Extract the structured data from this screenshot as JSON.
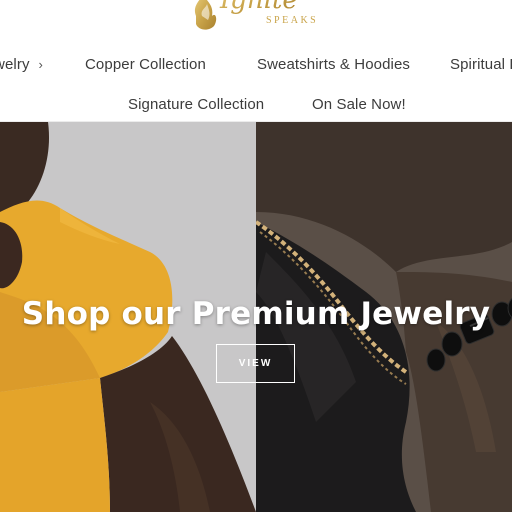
{
  "brand": {
    "logo_script": "Ignite",
    "logo_sub": "SPEAKS",
    "logo_color": "#c9a44a"
  },
  "nav": {
    "row1": [
      {
        "label": "Jewelry",
        "has_chevron": true,
        "chevron": "›"
      },
      {
        "label": "Copper Collection"
      },
      {
        "label": "Sweatshirts & Hoodies"
      },
      {
        "label": "Spiritual B"
      }
    ],
    "row2": [
      {
        "label": "Signature Collection"
      },
      {
        "label": "On Sale Now!"
      }
    ]
  },
  "hero": {
    "heading": "Shop our Premium Jewelry",
    "button_label": "VIEW",
    "left_bg": "#c8c7c8",
    "shirt_color": "#e7a92d",
    "right_bg": "#5a4f47"
  }
}
